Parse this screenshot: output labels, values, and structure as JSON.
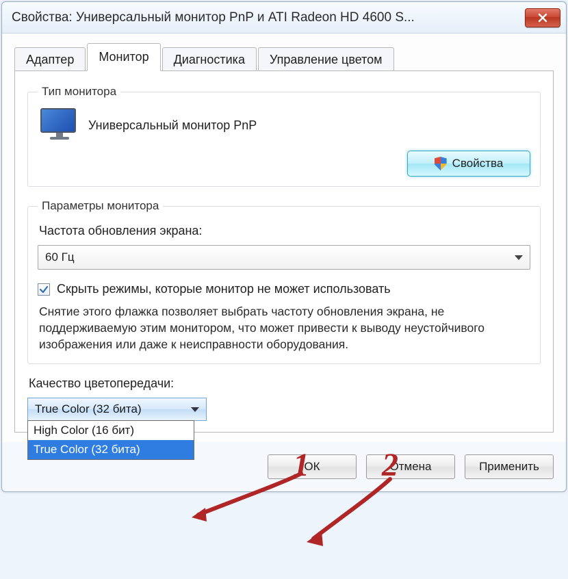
{
  "window": {
    "title": "Свойства: Универсальный монитор PnP и ATI Radeon HD 4600 S..."
  },
  "tabs": {
    "adapter": "Адаптер",
    "monitor": "Монитор",
    "diagnostics": "Диагностика",
    "color_mgmt": "Управление цветом"
  },
  "monitor_group": {
    "legend": "Тип монитора",
    "device_name": "Универсальный монитор PnP",
    "properties_btn": "Свойства"
  },
  "settings_group": {
    "legend": "Параметры монитора",
    "refresh_label": "Частота обновления экрана:",
    "refresh_value": "60 Гц",
    "hide_modes_checked": true,
    "hide_modes_label": "Скрыть режимы, которые монитор не может использовать",
    "hide_modes_desc": "Снятие этого флажка позволяет выбрать частоту обновления экрана, не поддерживаемую этим монитором, что может привести к выводу неустойчивого изображения или даже к неисправности оборудования."
  },
  "color_section": {
    "label": "Качество цветопередачи:",
    "selected": "True Color (32 бита)",
    "options": [
      "High Color (16 бит)",
      "True Color (32 бита)"
    ]
  },
  "buttons": {
    "ok": "ОК",
    "cancel": "Отмена",
    "apply": "Применить"
  },
  "annotations": {
    "one": "1",
    "two": "2"
  }
}
